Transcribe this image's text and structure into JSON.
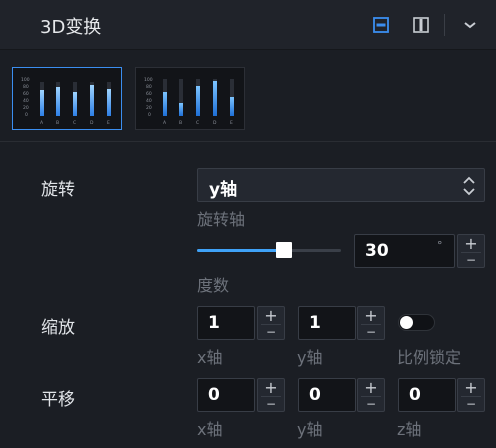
{
  "header": {
    "title": "3D变换",
    "icons": [
      "minimize-icon",
      "panel-icon",
      "chevron-down-icon"
    ],
    "accent": "#3b8ef0"
  },
  "presets": {
    "selected_index": 0,
    "items": [
      {
        "axis_ticks": [
          "100",
          "80",
          "60",
          "40",
          "20",
          "0"
        ],
        "categories": [
          "A",
          "B",
          "C",
          "D",
          "E"
        ]
      },
      {
        "axis_ticks": [
          "100",
          "80",
          "60",
          "40",
          "20",
          "0"
        ],
        "categories": [
          "A",
          "B",
          "C",
          "D",
          "E"
        ]
      }
    ]
  },
  "rotation": {
    "label": "旋转",
    "axis_select": {
      "value": "y轴",
      "caption": "旋转轴"
    },
    "degree": {
      "value": "30",
      "unit": "°",
      "caption": "度数",
      "slider_fraction": 0.59
    }
  },
  "scale": {
    "label": "缩放",
    "x": {
      "value": "1",
      "caption": "x轴"
    },
    "y": {
      "value": "1",
      "caption": "y轴"
    },
    "lock": {
      "caption": "比例锁定",
      "on": false
    }
  },
  "translate": {
    "label": "平移",
    "x": {
      "value": "0",
      "caption": "x轴"
    },
    "y": {
      "value": "0",
      "caption": "y轴"
    },
    "z": {
      "value": "0",
      "caption": "z轴"
    }
  },
  "stepper": {
    "plus": "+",
    "minus": "−"
  }
}
